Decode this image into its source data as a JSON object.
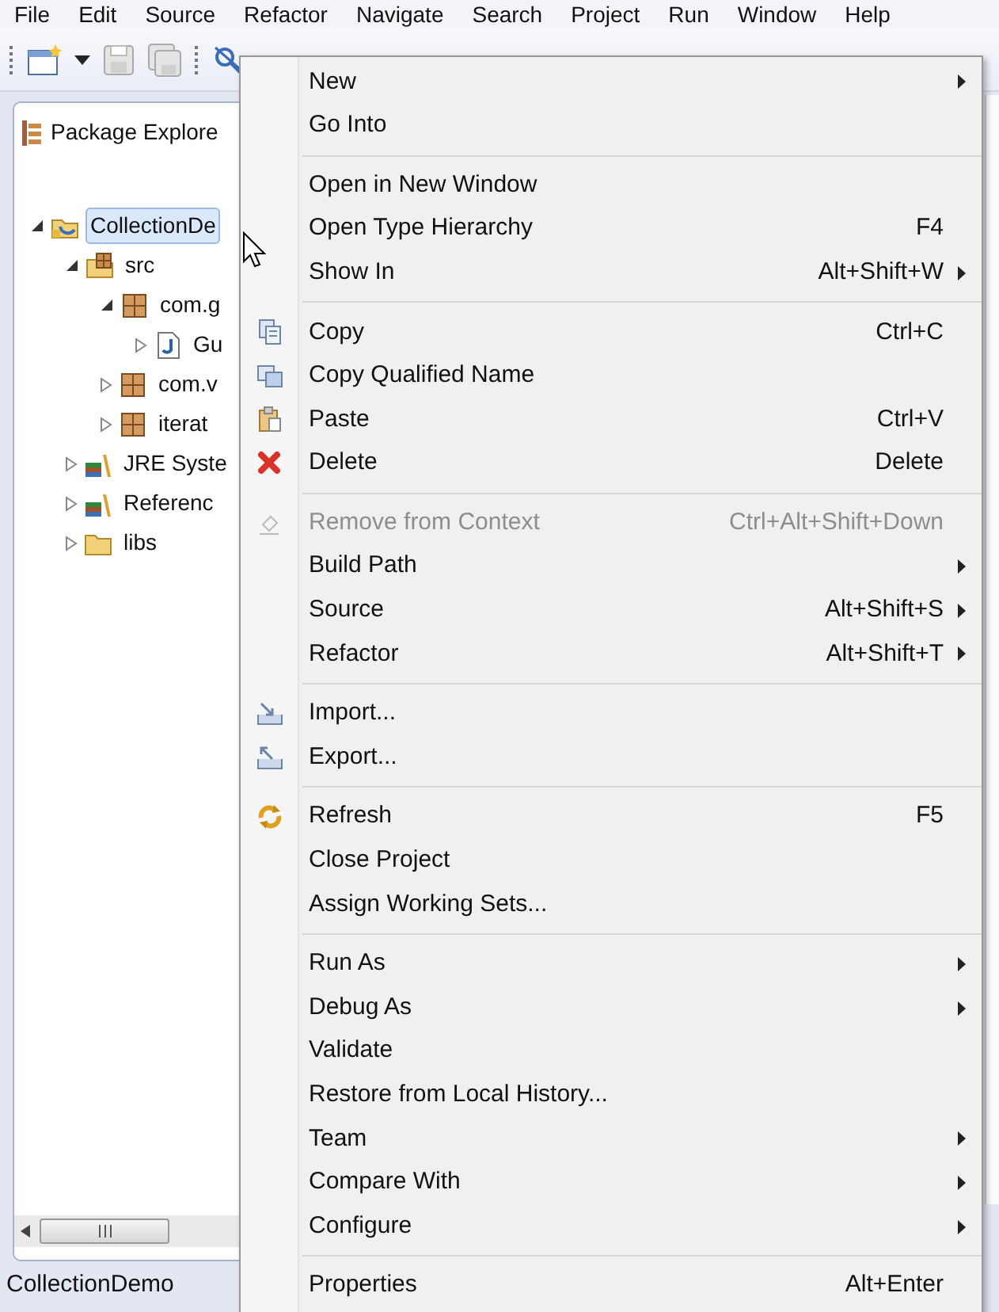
{
  "menubar": [
    "File",
    "Edit",
    "Source",
    "Refactor",
    "Navigate",
    "Search",
    "Project",
    "Run",
    "Window",
    "Help"
  ],
  "package_explorer": {
    "title": "Package Explore",
    "tree": [
      {
        "kind": "project",
        "label": "CollectionDe",
        "expanded": true,
        "selected": true,
        "children": [
          {
            "kind": "source-folder",
            "label": "src",
            "expanded": true,
            "selected": false,
            "children": [
              {
                "kind": "package",
                "label": "com.g",
                "expanded": true,
                "selected": false,
                "children": [
                  {
                    "kind": "java-file",
                    "label": "Gu",
                    "expanded": false,
                    "selected": false
                  }
                ]
              },
              {
                "kind": "package",
                "label": "com.v",
                "expanded": false,
                "selected": false
              },
              {
                "kind": "package",
                "label": "iterat",
                "expanded": false,
                "selected": false
              }
            ]
          },
          {
            "kind": "library",
            "label": "JRE Syste",
            "expanded": false,
            "selected": false
          },
          {
            "kind": "library",
            "label": "Referenc",
            "expanded": false,
            "selected": false
          },
          {
            "kind": "folder",
            "label": "libs",
            "expanded": false,
            "selected": false
          }
        ]
      }
    ]
  },
  "context_menu": {
    "items": [
      {
        "kind": "item",
        "label": "New",
        "submenu": true,
        "disabled": false
      },
      {
        "kind": "item",
        "label": "Go Into",
        "submenu": false,
        "disabled": false
      },
      {
        "kind": "separator"
      },
      {
        "kind": "item",
        "label": "Open in New Window",
        "submenu": false,
        "disabled": false
      },
      {
        "kind": "item",
        "label": "Open Type Hierarchy",
        "shortcut": "F4",
        "submenu": false,
        "disabled": false
      },
      {
        "kind": "item",
        "label": "Show In",
        "shortcut": "Alt+Shift+W",
        "submenu": true,
        "disabled": false
      },
      {
        "kind": "separator"
      },
      {
        "kind": "item",
        "label": "Copy",
        "shortcut": "Ctrl+C",
        "submenu": false,
        "disabled": false
      },
      {
        "kind": "item",
        "label": "Copy Qualified Name",
        "submenu": false,
        "disabled": false
      },
      {
        "kind": "item",
        "label": "Paste",
        "shortcut": "Ctrl+V",
        "submenu": false,
        "disabled": false
      },
      {
        "kind": "item",
        "label": "Delete",
        "shortcut": "Delete",
        "submenu": false,
        "disabled": false
      },
      {
        "kind": "separator"
      },
      {
        "kind": "item",
        "label": "Remove from Context",
        "shortcut": "Ctrl+Alt+Shift+Down",
        "submenu": false,
        "disabled": true
      },
      {
        "kind": "item",
        "label": "Build Path",
        "submenu": true,
        "disabled": false
      },
      {
        "kind": "item",
        "label": "Source",
        "shortcut": "Alt+Shift+S",
        "submenu": true,
        "disabled": false
      },
      {
        "kind": "item",
        "label": "Refactor",
        "shortcut": "Alt+Shift+T",
        "submenu": true,
        "disabled": false
      },
      {
        "kind": "separator"
      },
      {
        "kind": "item",
        "label": "Import...",
        "submenu": false,
        "disabled": false
      },
      {
        "kind": "item",
        "label": "Export...",
        "submenu": false,
        "disabled": false
      },
      {
        "kind": "separator"
      },
      {
        "kind": "item",
        "label": "Refresh",
        "shortcut": "F5",
        "submenu": false,
        "disabled": false
      },
      {
        "kind": "item",
        "label": "Close Project",
        "submenu": false,
        "disabled": false
      },
      {
        "kind": "item",
        "label": "Assign Working Sets...",
        "submenu": false,
        "disabled": false
      },
      {
        "kind": "separator"
      },
      {
        "kind": "item",
        "label": "Run As",
        "submenu": true,
        "disabled": false
      },
      {
        "kind": "item",
        "label": "Debug As",
        "submenu": true,
        "disabled": false
      },
      {
        "kind": "item",
        "label": "Validate",
        "submenu": false,
        "disabled": false
      },
      {
        "kind": "item",
        "label": "Restore from Local History...",
        "submenu": false,
        "disabled": false
      },
      {
        "kind": "item",
        "label": "Team",
        "submenu": true,
        "disabled": false
      },
      {
        "kind": "item",
        "label": "Compare With",
        "submenu": true,
        "disabled": false
      },
      {
        "kind": "item",
        "label": "Configure",
        "submenu": true,
        "disabled": false
      },
      {
        "kind": "separator"
      },
      {
        "kind": "item",
        "label": "Properties",
        "shortcut": "Alt+Enter",
        "submenu": false,
        "disabled": false
      }
    ]
  },
  "status_bar": {
    "text": "CollectionDemo"
  }
}
